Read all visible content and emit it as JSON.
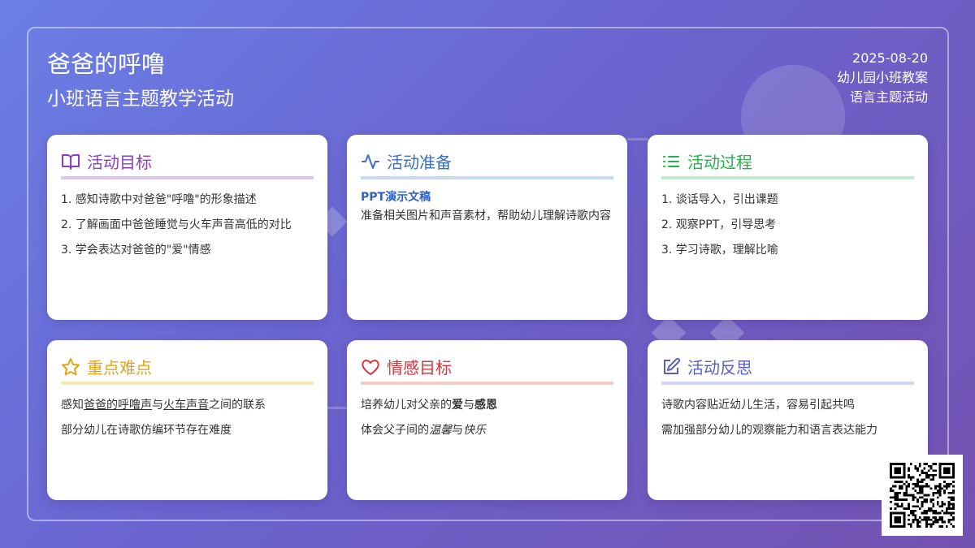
{
  "header": {
    "title": "爸爸的呼噜",
    "subtitle": "小班语言主题教学活动",
    "date": "2025-08-20",
    "category": "幼儿园小班教案",
    "theme": "语言主题活动"
  },
  "cards": {
    "goals": {
      "title": "活动目标",
      "icon": "book-icon",
      "color": "#8a3fc3",
      "underline": "#e0c6ef",
      "items": [
        "1. 感知诗歌中对爸爸\"呼噜\"的形象描述",
        "2. 了解画面中爸爸睡觉与火车声音高低的对比",
        "3. 学会表达对爸爸的\"爱\"情感"
      ]
    },
    "prep": {
      "title": "活动准备",
      "icon": "activity-icon",
      "color": "#3d6fc1",
      "underline": "#c9d9ef",
      "label": "PPT演示文稿",
      "text": "准备相关图片和声音素材，帮助幼儿理解诗歌内容"
    },
    "process": {
      "title": "活动过程",
      "icon": "list-icon",
      "color": "#22b14c",
      "underline": "#c2ecce",
      "items": [
        "1. 谈话导入，引出课题",
        "2. 观察PPT，引导思考",
        "3. 学习诗歌，理解比喻"
      ]
    },
    "keypoints": {
      "title": "重点难点",
      "icon": "star-icon",
      "color": "#e0a615",
      "underline": "#f7e6ae",
      "line1": {
        "pre": "感知",
        "u1": "爸爸的呼噜声",
        "mid": "与",
        "u2": "火车声音",
        "post": "之间的联系"
      },
      "line2": "部分幼儿在诗歌仿编环节存在难度"
    },
    "emotion": {
      "title": "情感目标",
      "icon": "heart-icon",
      "color": "#d9363e",
      "underline": "#f6caca",
      "line1": {
        "pre": "培养幼儿对父亲的",
        "b1": "爱",
        "mid": "与",
        "b2": "感恩"
      },
      "line2": {
        "pre": "体会父子间的",
        "i1": "温馨",
        "mid": "与",
        "i2": "快乐"
      }
    },
    "reflection": {
      "title": "活动反思",
      "icon": "edit-icon",
      "color": "#5a5fc0",
      "underline": "#d3d3f3",
      "items": [
        "诗歌内容贴近幼儿生活，容易引起共鸣",
        "需加强部分幼儿的观察能力和语言表达能力"
      ]
    }
  },
  "qr": {
    "icon": "qr-code-icon"
  }
}
